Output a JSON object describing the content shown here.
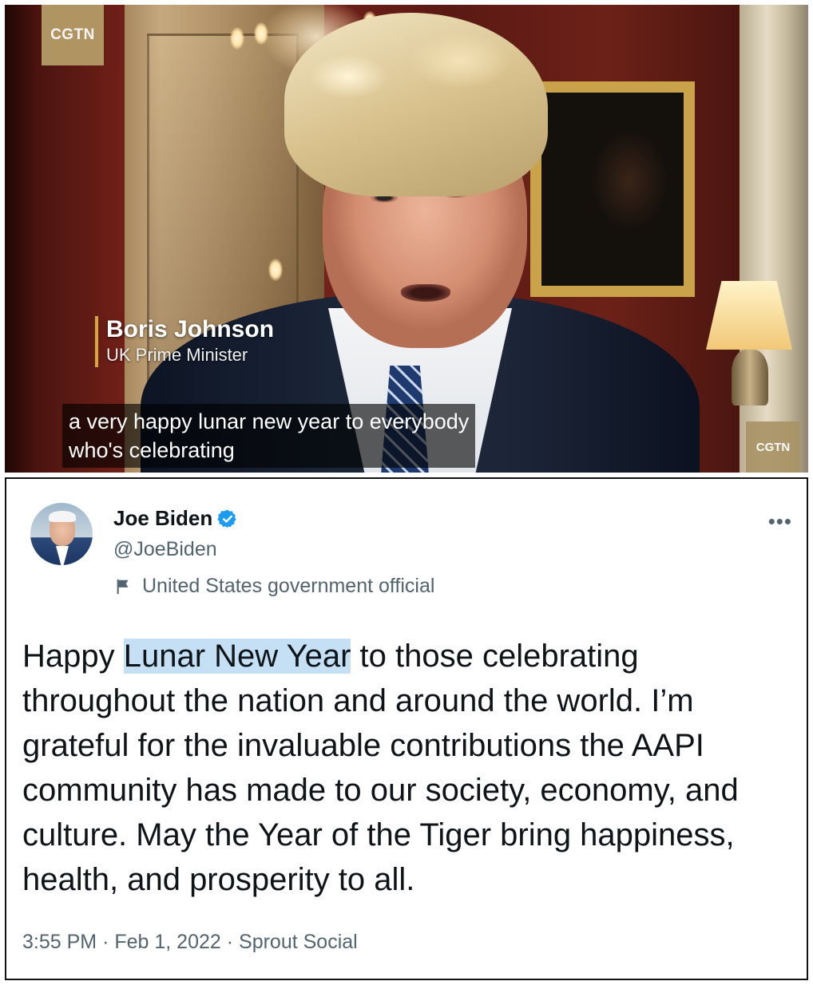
{
  "video": {
    "channel_logo": "CGTN",
    "channel_logo_small": "CGTN",
    "speaker_name": "Boris Johnson",
    "speaker_title": "UK Prime Minister",
    "subtitle_line1": "a very happy lunar new year to everybody",
    "subtitle_line2": "who's celebrating",
    "accent_color": "#d6a63a"
  },
  "tweet": {
    "display_name": "Joe Biden",
    "handle": "@JoeBiden",
    "account_label": "United States government official",
    "more_icon": "more-horizontal-icon",
    "verified_icon": "verified-badge-icon",
    "verified_color": "#1d9bf0",
    "text_before": "Happy ",
    "text_highlight": "Lunar New Year",
    "text_after": " to those celebrating throughout the nation and around the world. I’m grateful for the invaluable contributions the AAPI community has made to our society, economy, and culture. May the Year of the Tiger bring happiness, health, and prosperity to all.",
    "highlight_color": "#c5dff5",
    "time": "3:55 PM",
    "separator": "·",
    "date": "Feb 1, 2022",
    "source": "Sprout Social"
  }
}
